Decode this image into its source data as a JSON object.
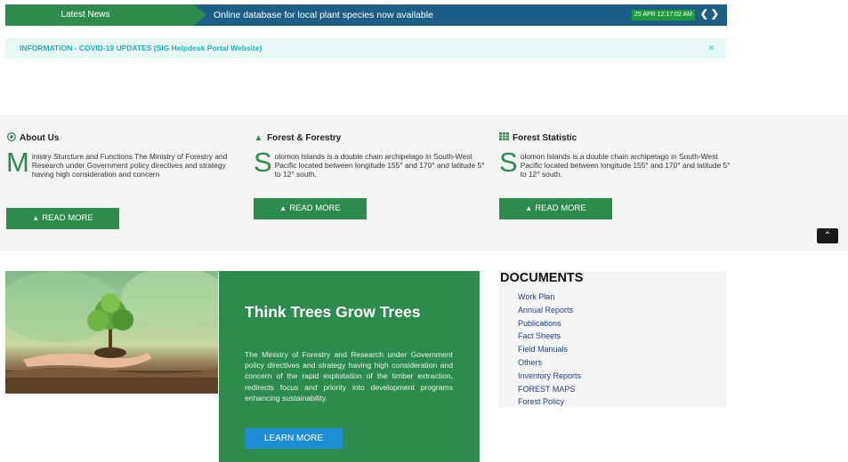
{
  "ticker": {
    "label": "Latest News",
    "headline": "Online database for local plant species now available",
    "time": "25 APR 12:17:02 AM",
    "prev_icon": "chevron-left-icon",
    "next_icon": "chevron-right-icon"
  },
  "alert": {
    "text": "INFORMATION - COVID-19 UPDATES (SIG Helpdesk Portal Website)",
    "close_icon": "close-icon"
  },
  "about": {
    "title": "About Us",
    "icon": "eye-icon",
    "dropcap": "M",
    "text": "inistry Sturcture and Functions The Ministry of Forestry and Research under Government policy directives and strategy having high consideration and concern",
    "button": "READ MORE"
  },
  "forest": {
    "title": "Forest & Forestry",
    "icon": "tree-icon",
    "dropcap": "S",
    "text": "olomon Islands is a double chain archipelago in South-West Pacific located between longitude 155° and 170° and latitude 5° to 12° south.",
    "button": "READ MORE"
  },
  "statistic": {
    "title": "Forest Statistic",
    "icon": "table-icon",
    "dropcap": "S",
    "text": "olomon Islands is a double chain archipelago in South-West Pacific located between longitude 155° and 170° and latitude 5° to 12° south.",
    "button": "READ MORE"
  },
  "card": {
    "title": "Think Trees Grow Trees",
    "text": "The Ministry of Forestry and Research under Government policy directives and strategy having high consideration and concern of the rapid exploitation of the timber extraction, redirects focus and priority into development programs enhancing sustainability.",
    "button": "LEARN MORE"
  },
  "documents": {
    "title": "DOCUMENTS",
    "items": [
      "Work Plan",
      "Annual Reports",
      "Publications",
      "Fact Sheets",
      "Field Manuals",
      "Others",
      "Inventory Reports",
      "FOREST MAPS",
      "Forest Policy"
    ]
  },
  "colors": {
    "brand_green": "#2e8b4e",
    "ticker_blue": "#1d5e86",
    "link_blue": "#1f3f8a",
    "alert_teal": "#1ab5b5",
    "button_blue": "#1e8ed8"
  }
}
